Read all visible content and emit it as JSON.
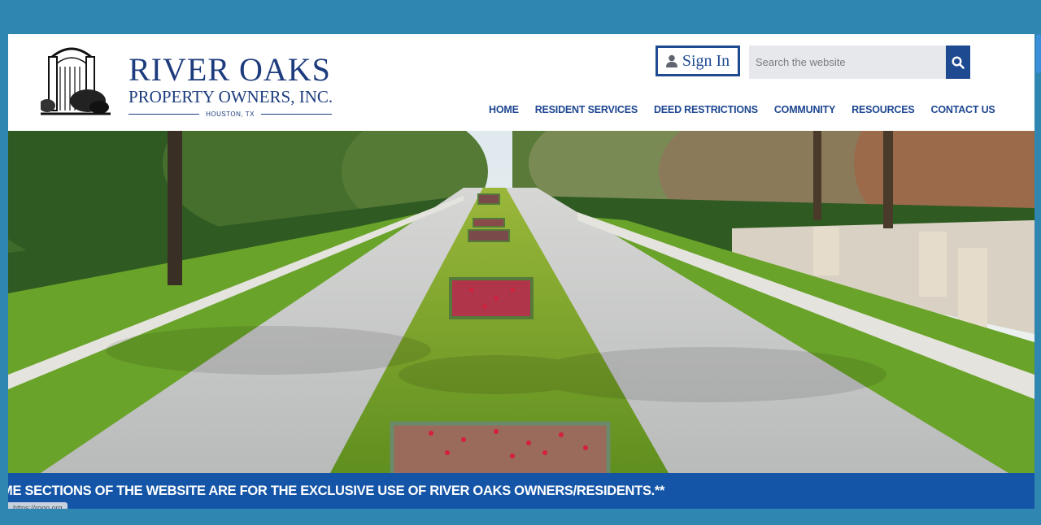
{
  "logo": {
    "title": "RIVER OAKS",
    "subtitle": "PROPERTY OWNERS, INC.",
    "location": "HOUSTON, TX",
    "emblem_icon": "gate-emblem-icon"
  },
  "header": {
    "signin_label": "Sign In",
    "signin_icon": "user-icon",
    "search_placeholder": "Search the website",
    "search_icon": "search-icon"
  },
  "nav": {
    "items": [
      {
        "label": "HOME"
      },
      {
        "label": "RESIDENT SERVICES"
      },
      {
        "label": "DEED RESTRICTIONS"
      },
      {
        "label": "COMMUNITY"
      },
      {
        "label": "RESOURCES"
      },
      {
        "label": "CONTACT US"
      }
    ]
  },
  "banner": {
    "text": "ME SECTIONS OF THE WEBSITE ARE FOR THE EXCLUSIVE USE OF RIVER OAKS OWNERS/RESIDENTS.**"
  },
  "status": {
    "url": "https://roop.org"
  },
  "colors": {
    "page_bg": "#2f86b0",
    "brand_blue": "#1d3c7d",
    "nav_blue": "#1d4690",
    "banner_blue": "#1455a8"
  }
}
